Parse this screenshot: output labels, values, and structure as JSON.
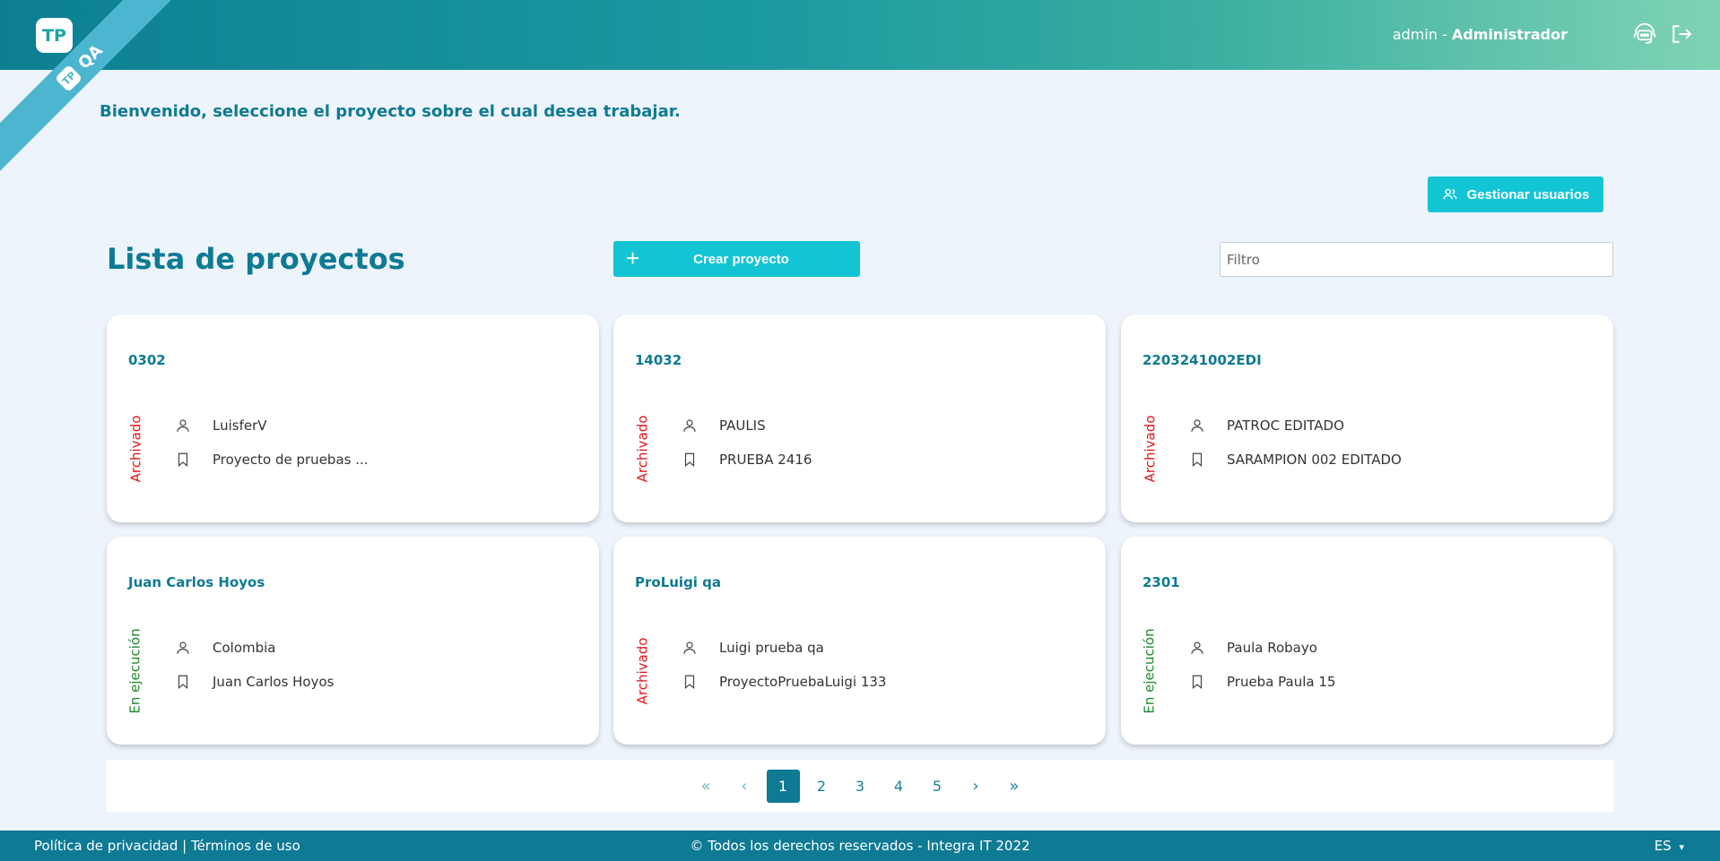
{
  "header": {
    "logo_text": "TP",
    "env_badge": "QA",
    "user": {
      "username": "admin",
      "separator": " - ",
      "role": "Administrador"
    },
    "icons": [
      "support-chat-icon",
      "logout-icon"
    ]
  },
  "main": {
    "welcome": "Bienvenido, seleccione el proyecto sobre el cual desea trabajar.",
    "manage_users_label": "Gestionar usuarios",
    "list_title": "Lista de proyectos",
    "create_project_label": "Crear proyecto",
    "filter_placeholder": "Filtro"
  },
  "projects": [
    {
      "code": "0302",
      "status": "Archivado",
      "owner": "LuisferV",
      "name": "Proyecto de pruebas ..."
    },
    {
      "code": "14032",
      "status": "Archivado",
      "owner": "PAULIS",
      "name": "PRUEBA 2416"
    },
    {
      "code": "2203241002EDI",
      "status": "Archivado",
      "owner": "PATROC EDITADO",
      "name": "SARAMPION 002 EDITADO"
    },
    {
      "code": "Juan Carlos Hoyos",
      "status": "En ejecución",
      "owner": "Colombia",
      "name": "Juan Carlos Hoyos"
    },
    {
      "code": "ProLuigi qa",
      "status": "Archivado",
      "owner": "Luigi prueba qa",
      "name": "ProyectoPruebaLuigi 133"
    },
    {
      "code": "2301",
      "status": "En ejecución",
      "owner": "Paula Robayo",
      "name": "Prueba Paula 15"
    }
  ],
  "pagination": {
    "first": "«",
    "prev": "‹",
    "pages": [
      "1",
      "2",
      "3",
      "4",
      "5"
    ],
    "current": "1",
    "next": "›",
    "last": "»"
  },
  "footer": {
    "links": "Política de privacidad | Términos de uso",
    "copyright": "© Todos los derechos reservados - Integra IT 2022",
    "language": "ES"
  },
  "colors": {
    "primary": "#0e7a94",
    "accent": "#13c5d4",
    "archived": "#e01919",
    "running": "#1f8a2b",
    "background": "#eef4fc"
  }
}
